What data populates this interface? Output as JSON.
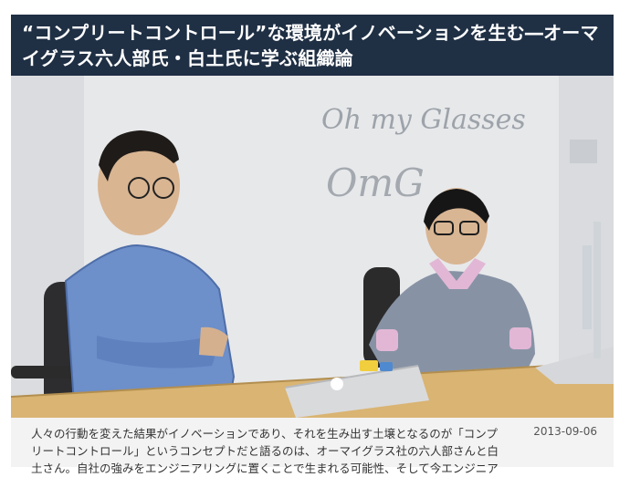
{
  "article": {
    "title": "“コンプリートコントロール”な環境がイノベーションを生む―オーマイグラス六人部氏・白土氏に学ぶ組織論",
    "excerpt": "人々の行動を変えた結果がイノベーションであり、それを生み出す土壌となるのが「コンプリートコントロール」というコンセプトだと語るのは、オーマイグラス社の六人部さんと白土さん。自社の強みをエンジニアリングに置くことで生まれる可能性、そして今エンジニア",
    "date": "2013-09-06"
  },
  "photo": {
    "wall_sign_top": "Oh my Glasses",
    "wall_sign_bottom": "OmG"
  }
}
